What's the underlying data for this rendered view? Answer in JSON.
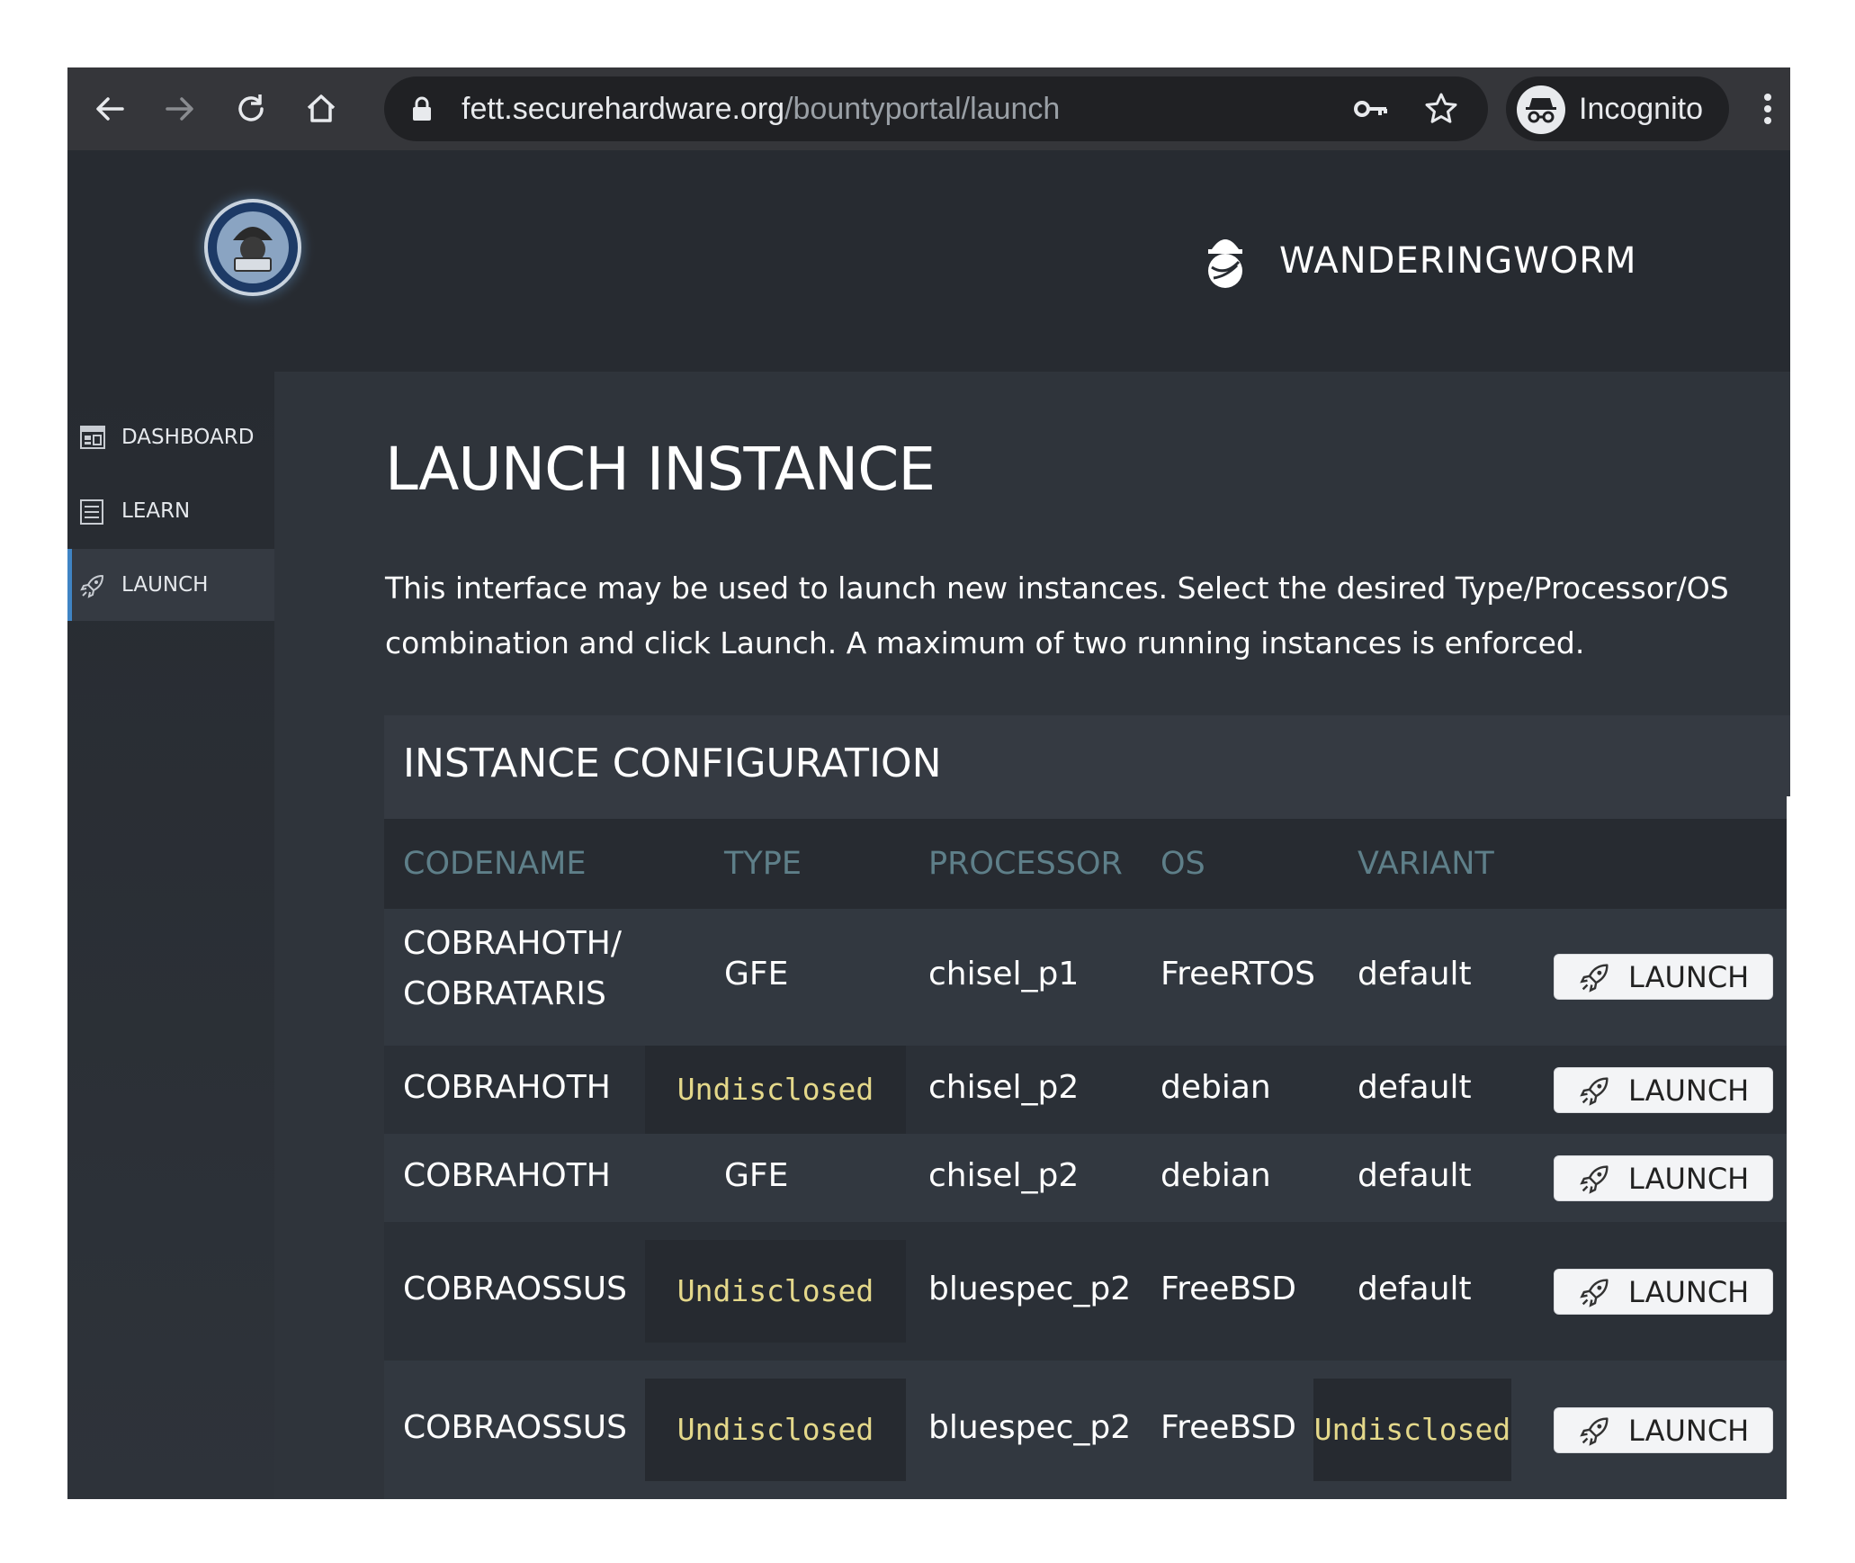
{
  "browser": {
    "url_host": "fett.securehardware.org",
    "url_path": "/bountyportal/launch",
    "profile_label": "Incognito",
    "icons": [
      "back-icon",
      "forward-icon",
      "reload-icon",
      "home-icon",
      "lock-icon",
      "key-icon",
      "star-icon",
      "incognito-icon",
      "more-icon"
    ]
  },
  "header": {
    "username": "WANDERINGWORM",
    "user_icon": "user-icon",
    "logo": "fett-logo"
  },
  "sidebar": {
    "items": [
      {
        "label": "DASHBOARD",
        "icon": "dashboard-icon",
        "active": false
      },
      {
        "label": "LEARN",
        "icon": "list-icon",
        "active": false
      },
      {
        "label": "LAUNCH",
        "icon": "rocket-icon",
        "active": true
      }
    ]
  },
  "main": {
    "title": "LAUNCH INSTANCE",
    "intro": "This interface may be used to launch new instances. Select the desired Type/Processor/OS combination and click Launch. A maximum of two running instances is enforced."
  },
  "config": {
    "title": "INSTANCE CONFIGURATION",
    "columns": [
      "CODENAME",
      "TYPE",
      "PROCESSOR",
      "OS",
      "VARIANT"
    ],
    "launch_label": "LAUNCH",
    "rows": [
      {
        "codename": "COBRAHOTH/ COBRATARIS",
        "codename_1": "COBRAHOTH/",
        "codename_2": "COBRATARIS",
        "type": "GFE",
        "processor": "chisel_p1",
        "os": "FreeRTOS",
        "variant": "default"
      },
      {
        "codename": "COBRAHOTH",
        "type": "Undisclosed",
        "processor": "chisel_p2",
        "os": "debian",
        "variant": "default"
      },
      {
        "codename": "COBRAHOTH",
        "type": "GFE",
        "processor": "chisel_p2",
        "os": "debian",
        "variant": "default"
      },
      {
        "codename": "COBRAOSSUS",
        "type": "Undisclosed",
        "processor": "bluespec_p2",
        "os": "FreeBSD",
        "variant": "default"
      },
      {
        "codename": "COBRAOSSUS",
        "type": "Undisclosed",
        "processor": "bluespec_p2",
        "os": "FreeBSD",
        "variant": "Undisclosed"
      }
    ]
  },
  "colors": {
    "toolbar": "#35363a",
    "page_bg": "#272b31",
    "main_bg": "#2f343b",
    "column_header_text": "#5e7f89",
    "undisclosed_text": "#e4d88a",
    "active_nav_accent": "#3f84c4"
  }
}
